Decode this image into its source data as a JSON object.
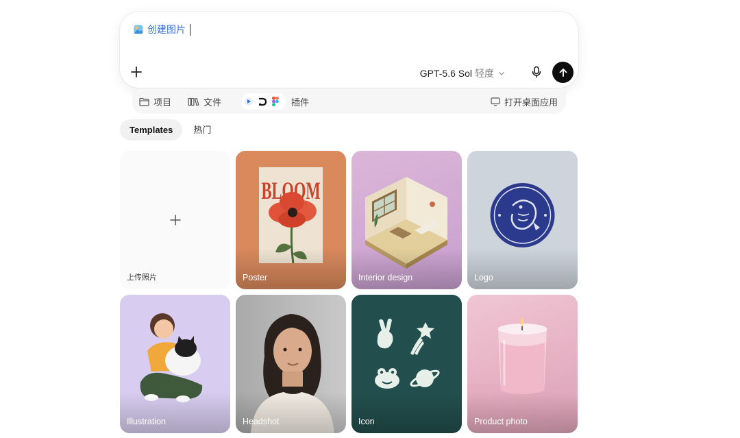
{
  "composer": {
    "prompt_label": "创建图片",
    "model_name": "GPT-5.6 Sol",
    "model_effort": "轻度"
  },
  "subbar": {
    "projects": "项目",
    "files": "文件",
    "plugins": "插件",
    "desktop": "打开桌面应用"
  },
  "tabs": {
    "templates": "Templates",
    "popular": "热门"
  },
  "cards": {
    "upload": "上传照片",
    "poster": "Poster",
    "interior": "Interior design",
    "logo": "Logo",
    "illustration": "Illustration",
    "headshot": "Headshot",
    "icon": "Icon",
    "product": "Product photo"
  },
  "poster_art_text": "BLOOM",
  "colors": {
    "accent_link": "#2f6fde",
    "send_button": "#0d0d0d",
    "poster_bg": "#d9895c",
    "interior_bg": "#d2a8d0",
    "logo_bg": "#cdd4dc",
    "logo_navy": "#2b3a8c",
    "illustration_bg": "#d8cdf0",
    "headshot_bg": "#b9b9b9",
    "icon_bg": "#224f4d",
    "product_bg": "#e8b6c8"
  }
}
